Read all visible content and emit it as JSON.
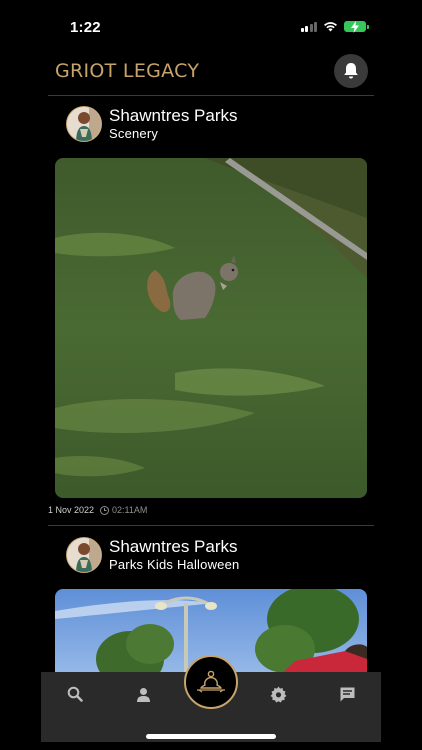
{
  "status_bar": {
    "time": "1:22"
  },
  "header": {
    "app_title": "GRIOT LEGACY"
  },
  "posts": [
    {
      "author": "Shawntres Parks",
      "caption": "Scenery",
      "date": "1 Nov 2022",
      "time": "02:11AM"
    },
    {
      "author": "Shawntres Parks",
      "caption": "Parks Kids Halloween"
    }
  ],
  "tabbar": {
    "items": [
      "search-icon",
      "profile-icon",
      "home-center-icon",
      "settings-icon",
      "messages-icon"
    ]
  },
  "colors": {
    "accent": "#c7a46a",
    "background": "#000000",
    "tabbar": "#2a2a2a"
  }
}
